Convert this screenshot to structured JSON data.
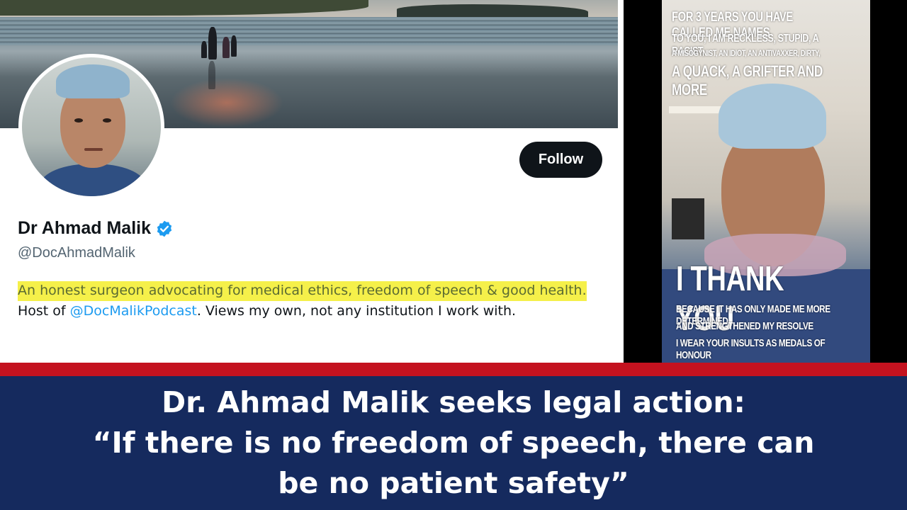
{
  "profile": {
    "display_name": "Dr Ahmad Malik",
    "handle": "@DocAhmadMalik",
    "follow_label": "Follow",
    "bio": {
      "highlighted": "An honest surgeon advocating for medical ethics, freedom of speech & good health.",
      "text_before_mention": " Host of ",
      "mention": "@DocMalikPodcast",
      "text_after_mention": ". Views my own, not any institution I work with."
    },
    "verified_icon": "verified-badge-icon",
    "colors": {
      "verified": "#1d9bf0",
      "highlight": "#f5f04a",
      "mention": "#1d9bf0"
    }
  },
  "selfie_text": {
    "line1": "FOR 3 YEARS YOU HAVE CALLED ME NAMES",
    "line2": "TO YOU, I AM RECKLESS, STUPID, A RACIST,",
    "line3": "A MISOGYNIST, AN IDIOT, AN ANTIVAXXER, DIRTY,",
    "line4": "A QUACK, A GRIFTER AND MORE",
    "line5": "I THANK YOU",
    "line6": "BECAUSE IT HAS ONLY MADE ME MORE DETERMINED",
    "line7": "AND STRENGTHENED MY RESOLVE",
    "line8": "I WEAR YOUR INSULTS AS MEDALS OF HONOUR"
  },
  "headline": {
    "line1": "Dr. Ahmad Malik seeks legal action:",
    "line2": "“If there is no freedom of speech, there can",
    "line3": "be no patient safety”"
  },
  "colors": {
    "band": "#152a5e",
    "stripe": "#c4121f"
  }
}
